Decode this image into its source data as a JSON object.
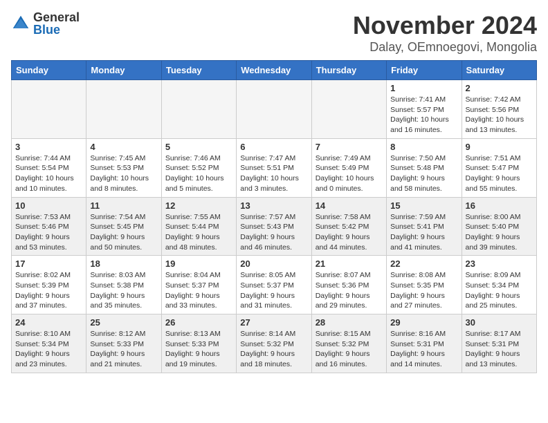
{
  "logo": {
    "general": "General",
    "blue": "Blue"
  },
  "title": "November 2024",
  "location": "Dalay, OEmnoegovi, Mongolia",
  "days_of_week": [
    "Sunday",
    "Monday",
    "Tuesday",
    "Wednesday",
    "Thursday",
    "Friday",
    "Saturday"
  ],
  "weeks": [
    [
      {
        "day": "",
        "info": "",
        "empty": true
      },
      {
        "day": "",
        "info": "",
        "empty": true
      },
      {
        "day": "",
        "info": "",
        "empty": true
      },
      {
        "day": "",
        "info": "",
        "empty": true
      },
      {
        "day": "",
        "info": "",
        "empty": true
      },
      {
        "day": "1",
        "info": "Sunrise: 7:41 AM\nSunset: 5:57 PM\nDaylight: 10 hours\nand 16 minutes.",
        "empty": false
      },
      {
        "day": "2",
        "info": "Sunrise: 7:42 AM\nSunset: 5:56 PM\nDaylight: 10 hours\nand 13 minutes.",
        "empty": false
      }
    ],
    [
      {
        "day": "3",
        "info": "Sunrise: 7:44 AM\nSunset: 5:54 PM\nDaylight: 10 hours\nand 10 minutes.",
        "empty": false
      },
      {
        "day": "4",
        "info": "Sunrise: 7:45 AM\nSunset: 5:53 PM\nDaylight: 10 hours\nand 8 minutes.",
        "empty": false
      },
      {
        "day": "5",
        "info": "Sunrise: 7:46 AM\nSunset: 5:52 PM\nDaylight: 10 hours\nand 5 minutes.",
        "empty": false
      },
      {
        "day": "6",
        "info": "Sunrise: 7:47 AM\nSunset: 5:51 PM\nDaylight: 10 hours\nand 3 minutes.",
        "empty": false
      },
      {
        "day": "7",
        "info": "Sunrise: 7:49 AM\nSunset: 5:49 PM\nDaylight: 10 hours\nand 0 minutes.",
        "empty": false
      },
      {
        "day": "8",
        "info": "Sunrise: 7:50 AM\nSunset: 5:48 PM\nDaylight: 9 hours\nand 58 minutes.",
        "empty": false
      },
      {
        "day": "9",
        "info": "Sunrise: 7:51 AM\nSunset: 5:47 PM\nDaylight: 9 hours\nand 55 minutes.",
        "empty": false
      }
    ],
    [
      {
        "day": "10",
        "info": "Sunrise: 7:53 AM\nSunset: 5:46 PM\nDaylight: 9 hours\nand 53 minutes.",
        "empty": false
      },
      {
        "day": "11",
        "info": "Sunrise: 7:54 AM\nSunset: 5:45 PM\nDaylight: 9 hours\nand 50 minutes.",
        "empty": false
      },
      {
        "day": "12",
        "info": "Sunrise: 7:55 AM\nSunset: 5:44 PM\nDaylight: 9 hours\nand 48 minutes.",
        "empty": false
      },
      {
        "day": "13",
        "info": "Sunrise: 7:57 AM\nSunset: 5:43 PM\nDaylight: 9 hours\nand 46 minutes.",
        "empty": false
      },
      {
        "day": "14",
        "info": "Sunrise: 7:58 AM\nSunset: 5:42 PM\nDaylight: 9 hours\nand 44 minutes.",
        "empty": false
      },
      {
        "day": "15",
        "info": "Sunrise: 7:59 AM\nSunset: 5:41 PM\nDaylight: 9 hours\nand 41 minutes.",
        "empty": false
      },
      {
        "day": "16",
        "info": "Sunrise: 8:00 AM\nSunset: 5:40 PM\nDaylight: 9 hours\nand 39 minutes.",
        "empty": false
      }
    ],
    [
      {
        "day": "17",
        "info": "Sunrise: 8:02 AM\nSunset: 5:39 PM\nDaylight: 9 hours\nand 37 minutes.",
        "empty": false
      },
      {
        "day": "18",
        "info": "Sunrise: 8:03 AM\nSunset: 5:38 PM\nDaylight: 9 hours\nand 35 minutes.",
        "empty": false
      },
      {
        "day": "19",
        "info": "Sunrise: 8:04 AM\nSunset: 5:37 PM\nDaylight: 9 hours\nand 33 minutes.",
        "empty": false
      },
      {
        "day": "20",
        "info": "Sunrise: 8:05 AM\nSunset: 5:37 PM\nDaylight: 9 hours\nand 31 minutes.",
        "empty": false
      },
      {
        "day": "21",
        "info": "Sunrise: 8:07 AM\nSunset: 5:36 PM\nDaylight: 9 hours\nand 29 minutes.",
        "empty": false
      },
      {
        "day": "22",
        "info": "Sunrise: 8:08 AM\nSunset: 5:35 PM\nDaylight: 9 hours\nand 27 minutes.",
        "empty": false
      },
      {
        "day": "23",
        "info": "Sunrise: 8:09 AM\nSunset: 5:34 PM\nDaylight: 9 hours\nand 25 minutes.",
        "empty": false
      }
    ],
    [
      {
        "day": "24",
        "info": "Sunrise: 8:10 AM\nSunset: 5:34 PM\nDaylight: 9 hours\nand 23 minutes.",
        "empty": false
      },
      {
        "day": "25",
        "info": "Sunrise: 8:12 AM\nSunset: 5:33 PM\nDaylight: 9 hours\nand 21 minutes.",
        "empty": false
      },
      {
        "day": "26",
        "info": "Sunrise: 8:13 AM\nSunset: 5:33 PM\nDaylight: 9 hours\nand 19 minutes.",
        "empty": false
      },
      {
        "day": "27",
        "info": "Sunrise: 8:14 AM\nSunset: 5:32 PM\nDaylight: 9 hours\nand 18 minutes.",
        "empty": false
      },
      {
        "day": "28",
        "info": "Sunrise: 8:15 AM\nSunset: 5:32 PM\nDaylight: 9 hours\nand 16 minutes.",
        "empty": false
      },
      {
        "day": "29",
        "info": "Sunrise: 8:16 AM\nSunset: 5:31 PM\nDaylight: 9 hours\nand 14 minutes.",
        "empty": false
      },
      {
        "day": "30",
        "info": "Sunrise: 8:17 AM\nSunset: 5:31 PM\nDaylight: 9 hours\nand 13 minutes.",
        "empty": false
      }
    ]
  ]
}
